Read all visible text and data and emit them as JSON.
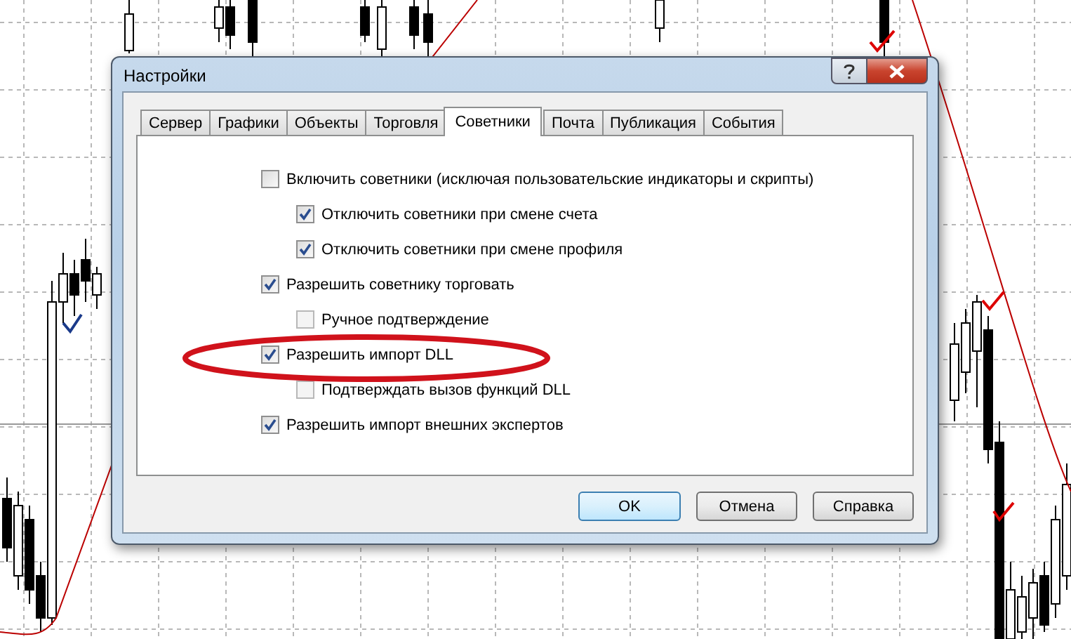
{
  "window": {
    "title": "Настройки"
  },
  "tabs": [
    {
      "label": "Сервер",
      "selected": false
    },
    {
      "label": "Графики",
      "selected": false
    },
    {
      "label": "Объекты",
      "selected": false
    },
    {
      "label": "Торговля",
      "selected": false
    },
    {
      "label": "Советники",
      "selected": true
    },
    {
      "label": "Почта",
      "selected": false
    },
    {
      "label": "Публикация",
      "selected": false
    },
    {
      "label": "События",
      "selected": false
    }
  ],
  "options": [
    {
      "label": "Включить советники (исключая пользовательские индикаторы и скрипты)",
      "checked": false,
      "disabled": false,
      "children": [
        {
          "label": "Отключить советники при смене счета",
          "checked": true,
          "disabled": false
        },
        {
          "label": "Отключить советники при смене профиля",
          "checked": true,
          "disabled": false
        }
      ]
    },
    {
      "label": "Разрешить советнику торговать",
      "checked": true,
      "disabled": false,
      "children": [
        {
          "label": "Ручное подтверждение",
          "checked": false,
          "disabled": true
        }
      ]
    },
    {
      "label": "Разрешить импорт DLL",
      "checked": true,
      "disabled": false,
      "highlighted": true,
      "children": [
        {
          "label": "Подтверждать вызов функций DLL",
          "checked": false,
          "disabled": true
        }
      ]
    },
    {
      "label": "Разрешить импорт внешних экспертов",
      "checked": true,
      "disabled": false
    }
  ],
  "buttons": [
    {
      "label": "OK",
      "default": true
    },
    {
      "label": "Отмена",
      "default": false
    },
    {
      "label": "Справка",
      "default": false
    }
  ]
}
